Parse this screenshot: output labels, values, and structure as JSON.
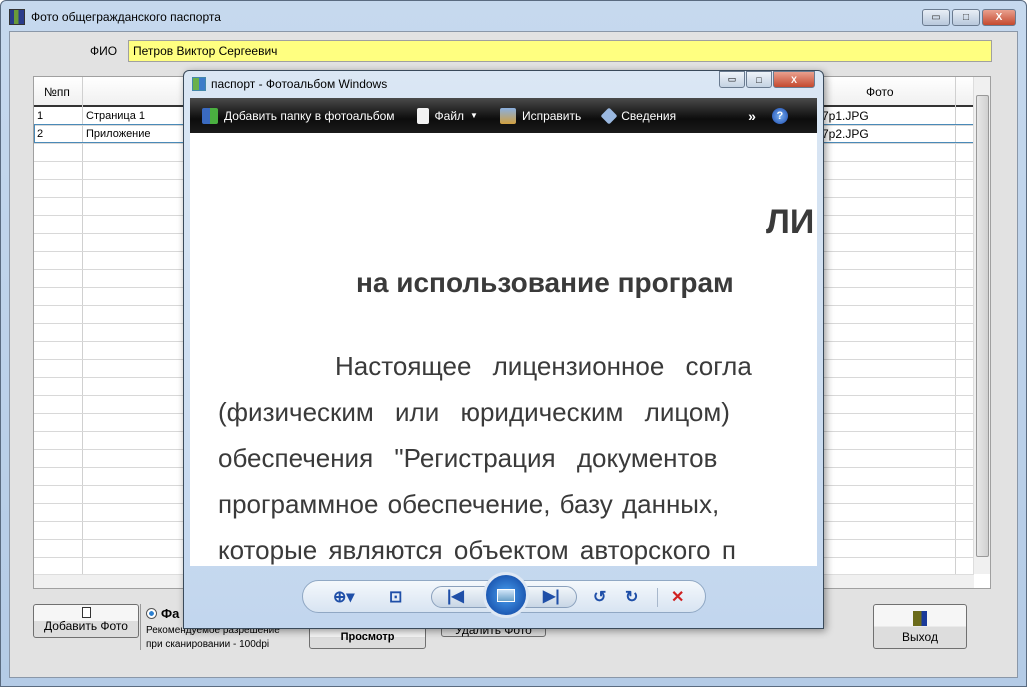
{
  "window": {
    "title": "Фото общегражданского паспорта",
    "min": "▭",
    "max": "□",
    "close": "X"
  },
  "fio": {
    "label": "ФИО",
    "value": "Петров Виктор Сергеевич"
  },
  "grid": {
    "headers": [
      "№пп",
      "Фото"
    ],
    "rows": [
      {
        "num": "1",
        "name": "Страница 1",
        "photo": "7p1.JPG"
      },
      {
        "num": "2",
        "name": "Приложение",
        "photo": "7p2.JPG"
      }
    ]
  },
  "buttons": {
    "add_photo": "Добавить Фото",
    "view": "Просмотр",
    "delete_photo": "Удалить Фото",
    "exit": "Выход"
  },
  "radio": {
    "label": "Фа",
    "hint1": "Рекомендуемое разрешение",
    "hint2": "при сканировании - 100dpi"
  },
  "viewer": {
    "title": "паспорт - Фотоальбом Windows",
    "toolbar": {
      "add_folder": "Добавить папку в фотоальбом",
      "file": "Файл",
      "fix": "Исправить",
      "info": "Сведения",
      "more": "»",
      "help": "?"
    },
    "document": {
      "h1": "ЛИ",
      "h2": "на использование програм",
      "lines": [
        "Настоящее лицензионное согла",
        "(физическим или юридическим лицом)",
        "обеспечения \"Регистрация документов",
        "программное обеспечение, базу данных,",
        "которые являются объектом авторского п"
      ]
    }
  }
}
